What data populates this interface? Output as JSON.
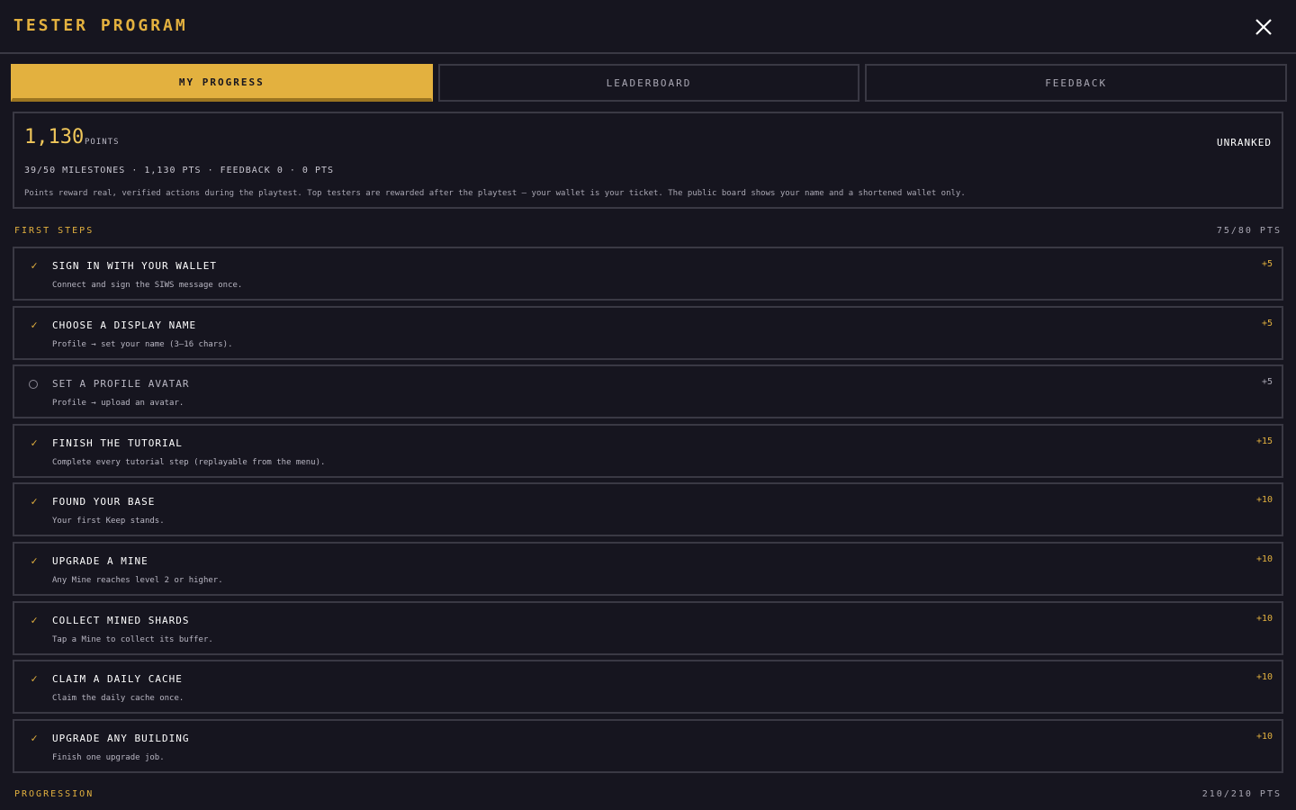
{
  "header": {
    "title": "TESTER PROGRAM",
    "close_icon": "close-icon"
  },
  "tabs": [
    {
      "label": "MY PROGRESS",
      "active": true
    },
    {
      "label": "LEADERBOARD",
      "active": false
    },
    {
      "label": "FEEDBACK",
      "active": false
    }
  ],
  "summary": {
    "points": "1,130",
    "points_label": "POINTS",
    "rank": "UNRANKED",
    "stats": "39/50 MILESTONES · 1,130 PTS · FEEDBACK 0 · 0 PTS",
    "note": "Points reward real, verified actions during the playtest. Top testers are rewarded after the playtest — your wallet is your ticket. The public board shows your name and a shortened wallet only."
  },
  "sections": [
    {
      "name": "FIRST STEPS",
      "points": "75/80 PTS",
      "items": [
        {
          "title": "SIGN IN WITH YOUR WALLET",
          "desc": "Connect and sign the SIWS message once.",
          "points": "+5",
          "done": true
        },
        {
          "title": "CHOOSE A DISPLAY NAME",
          "desc": "Profile → set your name (3–16 chars).",
          "points": "+5",
          "done": true
        },
        {
          "title": "SET A PROFILE AVATAR",
          "desc": "Profile → upload an avatar.",
          "points": "+5",
          "done": false
        },
        {
          "title": "FINISH THE TUTORIAL",
          "desc": "Complete every tutorial step (replayable from the menu).",
          "points": "+15",
          "done": true
        },
        {
          "title": "FOUND YOUR BASE",
          "desc": "Your first Keep stands.",
          "points": "+10",
          "done": true
        },
        {
          "title": "UPGRADE A MINE",
          "desc": "Any Mine reaches level 2 or higher.",
          "points": "+10",
          "done": true
        },
        {
          "title": "COLLECT MINED SHARDS",
          "desc": "Tap a Mine to collect its buffer.",
          "points": "+10",
          "done": true
        },
        {
          "title": "CLAIM A DAILY CACHE",
          "desc": "Claim the daily cache once.",
          "points": "+10",
          "done": true
        },
        {
          "title": "UPGRADE ANY BUILDING",
          "desc": "Finish one upgrade job.",
          "points": "+10",
          "done": true
        }
      ]
    },
    {
      "name": "PROGRESSION",
      "points": "210/210 PTS",
      "items": []
    }
  ],
  "icons": {
    "done": "check-icon",
    "todo": "circle-icon"
  },
  "colors": {
    "accent": "#e3b13f",
    "background": "#16151f",
    "border": "#3a3944"
  }
}
